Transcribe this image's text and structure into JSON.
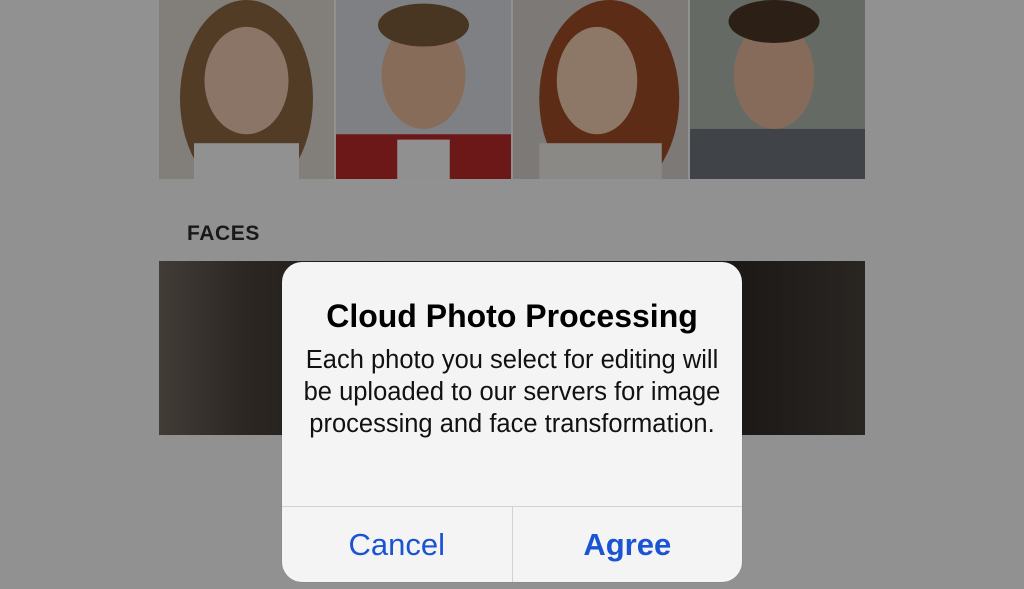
{
  "screen": {
    "photos": [
      {
        "name": "portrait-1",
        "bg": "#d9d4cd",
        "hair": "#8a6440",
        "skin": "#e6c4aa",
        "shirt": "#f2f2f2"
      },
      {
        "name": "portrait-2",
        "bg": "#d2d6da",
        "hair": "#7a5a3a",
        "skin": "#e2b597",
        "shirt": "#b42828"
      },
      {
        "name": "portrait-3",
        "bg": "#cfcac5",
        "hair": "#9a4a26",
        "skin": "#ecc8ae",
        "shirt": "#e8e4df"
      },
      {
        "name": "portrait-4",
        "bg": "#a9b3a7",
        "hair": "#4a3626",
        "skin": "#e0b398",
        "shirt": "#6b7079"
      }
    ],
    "section_header": "FACES"
  },
  "alert": {
    "title": "Cloud Photo Processing",
    "message": "Each photo you select for editing will be uploaded to our servers for image processing and face transformation.",
    "cancel_label": "Cancel",
    "agree_label": "Agree",
    "accent": "#1a54d4"
  }
}
